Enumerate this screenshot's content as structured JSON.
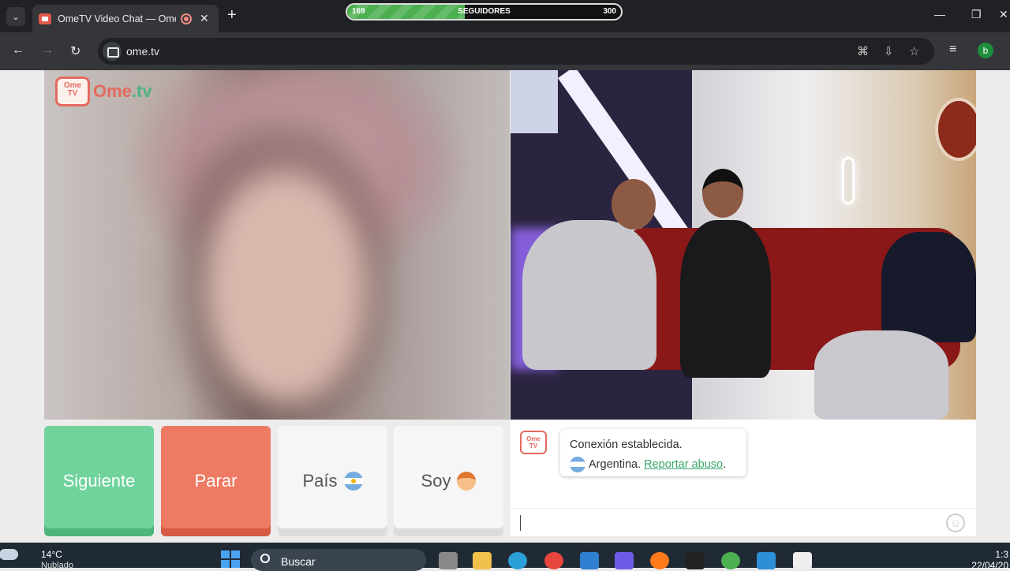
{
  "browser": {
    "tab_title": "OmeTV Video Chat — Ome",
    "url": "ome.tv",
    "profile_initial": "b"
  },
  "followers_bar": {
    "min": "169",
    "label": "SEGUIDORES",
    "max": "300",
    "progress_fraction": 0.43
  },
  "logo": {
    "tv_text_top": "Ome",
    "tv_text_bottom": "TV",
    "word_ome": "Ome",
    "word_tv": ".tv"
  },
  "buttons": {
    "next": "Siguiente",
    "stop": "Parar",
    "country": "País",
    "gender": "Soy"
  },
  "chat": {
    "message_line1": "Conexión establecida.",
    "country": "Argentina.",
    "report_link": "Reportar abuso",
    "trailing_period": "."
  },
  "taskbar": {
    "temperature": "14°C",
    "weather": "Nublado",
    "search_placeholder": "Buscar",
    "time": "1:3",
    "date": "22/04/20"
  },
  "colors": {
    "next_green": "#6fd39b",
    "stop_red": "#ef7a63",
    "brand_red": "#e46a5f",
    "link_green": "#3aa86b"
  }
}
